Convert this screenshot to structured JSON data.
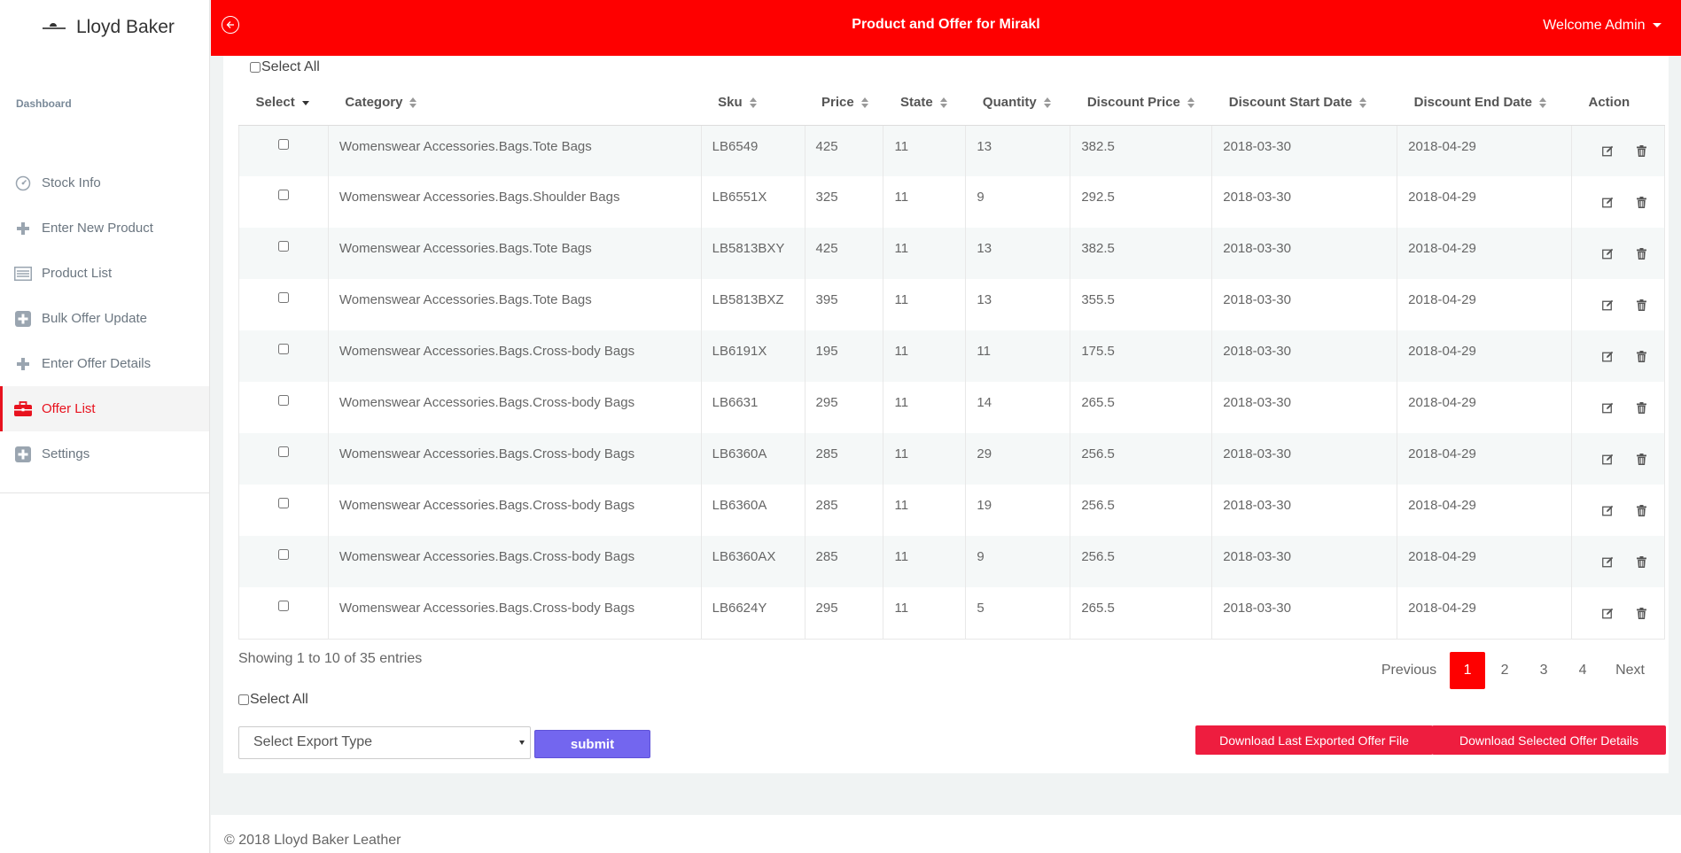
{
  "brand": {
    "name": "Lloyd Baker"
  },
  "sidebar": {
    "section_title": "Dashboard",
    "items": [
      {
        "label": "Stock Info",
        "icon": "dashboard-gauge-icon"
      },
      {
        "label": "Enter New Product",
        "icon": "plus-icon"
      },
      {
        "label": "Product List",
        "icon": "list-icon"
      },
      {
        "label": "Bulk Offer Update",
        "icon": "plus-square-icon"
      },
      {
        "label": "Enter Offer Details",
        "icon": "plus-icon"
      },
      {
        "label": "Offer List",
        "icon": "briefcase-icon",
        "active": true
      },
      {
        "label": "Settings",
        "icon": "plus-square-icon"
      }
    ]
  },
  "topbar": {
    "title": "Product and Offer for Mirakl",
    "welcome_prefix": "Welcome",
    "user": "Admin"
  },
  "table": {
    "select_all_label": "Select All",
    "columns": [
      "Select",
      "Category",
      "Sku",
      "Price",
      "State",
      "Quantity",
      "Discount Price",
      "Discount Start Date",
      "Discount End Date",
      "Action"
    ],
    "rows": [
      [
        "Womenswear Accessories.Bags.Tote Bags",
        "LB6549",
        "425",
        "11",
        "13",
        "382.5",
        "2018-03-30",
        "2018-04-29"
      ],
      [
        "Womenswear Accessories.Bags.Shoulder Bags",
        "LB6551X",
        "325",
        "11",
        "9",
        "292.5",
        "2018-03-30",
        "2018-04-29"
      ],
      [
        "Womenswear Accessories.Bags.Tote Bags",
        "LB5813BXY",
        "425",
        "11",
        "13",
        "382.5",
        "2018-03-30",
        "2018-04-29"
      ],
      [
        "Womenswear Accessories.Bags.Tote Bags",
        "LB5813BXZ",
        "395",
        "11",
        "13",
        "355.5",
        "2018-03-30",
        "2018-04-29"
      ],
      [
        "Womenswear Accessories.Bags.Cross-body Bags",
        "LB6191X",
        "195",
        "11",
        "11",
        "175.5",
        "2018-03-30",
        "2018-04-29"
      ],
      [
        "Womenswear Accessories.Bags.Cross-body Bags",
        "LB6631",
        "295",
        "11",
        "14",
        "265.5",
        "2018-03-30",
        "2018-04-29"
      ],
      [
        "Womenswear Accessories.Bags.Cross-body Bags",
        "LB6360A",
        "285",
        "11",
        "29",
        "256.5",
        "2018-03-30",
        "2018-04-29"
      ],
      [
        "Womenswear Accessories.Bags.Cross-body Bags",
        "LB6360A",
        "285",
        "11",
        "19",
        "256.5",
        "2018-03-30",
        "2018-04-29"
      ],
      [
        "Womenswear Accessories.Bags.Cross-body Bags",
        "LB6360AX",
        "285",
        "11",
        "9",
        "256.5",
        "2018-03-30",
        "2018-04-29"
      ],
      [
        "Womenswear Accessories.Bags.Cross-body Bags",
        "LB6624Y",
        "295",
        "11",
        "5",
        "265.5",
        "2018-03-30",
        "2018-04-29"
      ]
    ],
    "showing_text": "Showing 1 to 10 of 35 entries"
  },
  "pagination": {
    "previous": "Previous",
    "pages": [
      "1",
      "2",
      "3",
      "4"
    ],
    "current": "1",
    "next": "Next"
  },
  "bottom": {
    "select_all_label": "Select All",
    "export_placeholder": "Select Export Type",
    "submit_label": "submit",
    "download_last_label": "Download Last Exported Offer File",
    "download_selected_label": "Download Selected Offer Details"
  },
  "footer": {
    "text": "© 2018 Lloyd Baker Leather"
  },
  "colors": {
    "accent": "#fe0000",
    "submit": "#7366ef",
    "download": "#ee1d3f"
  }
}
